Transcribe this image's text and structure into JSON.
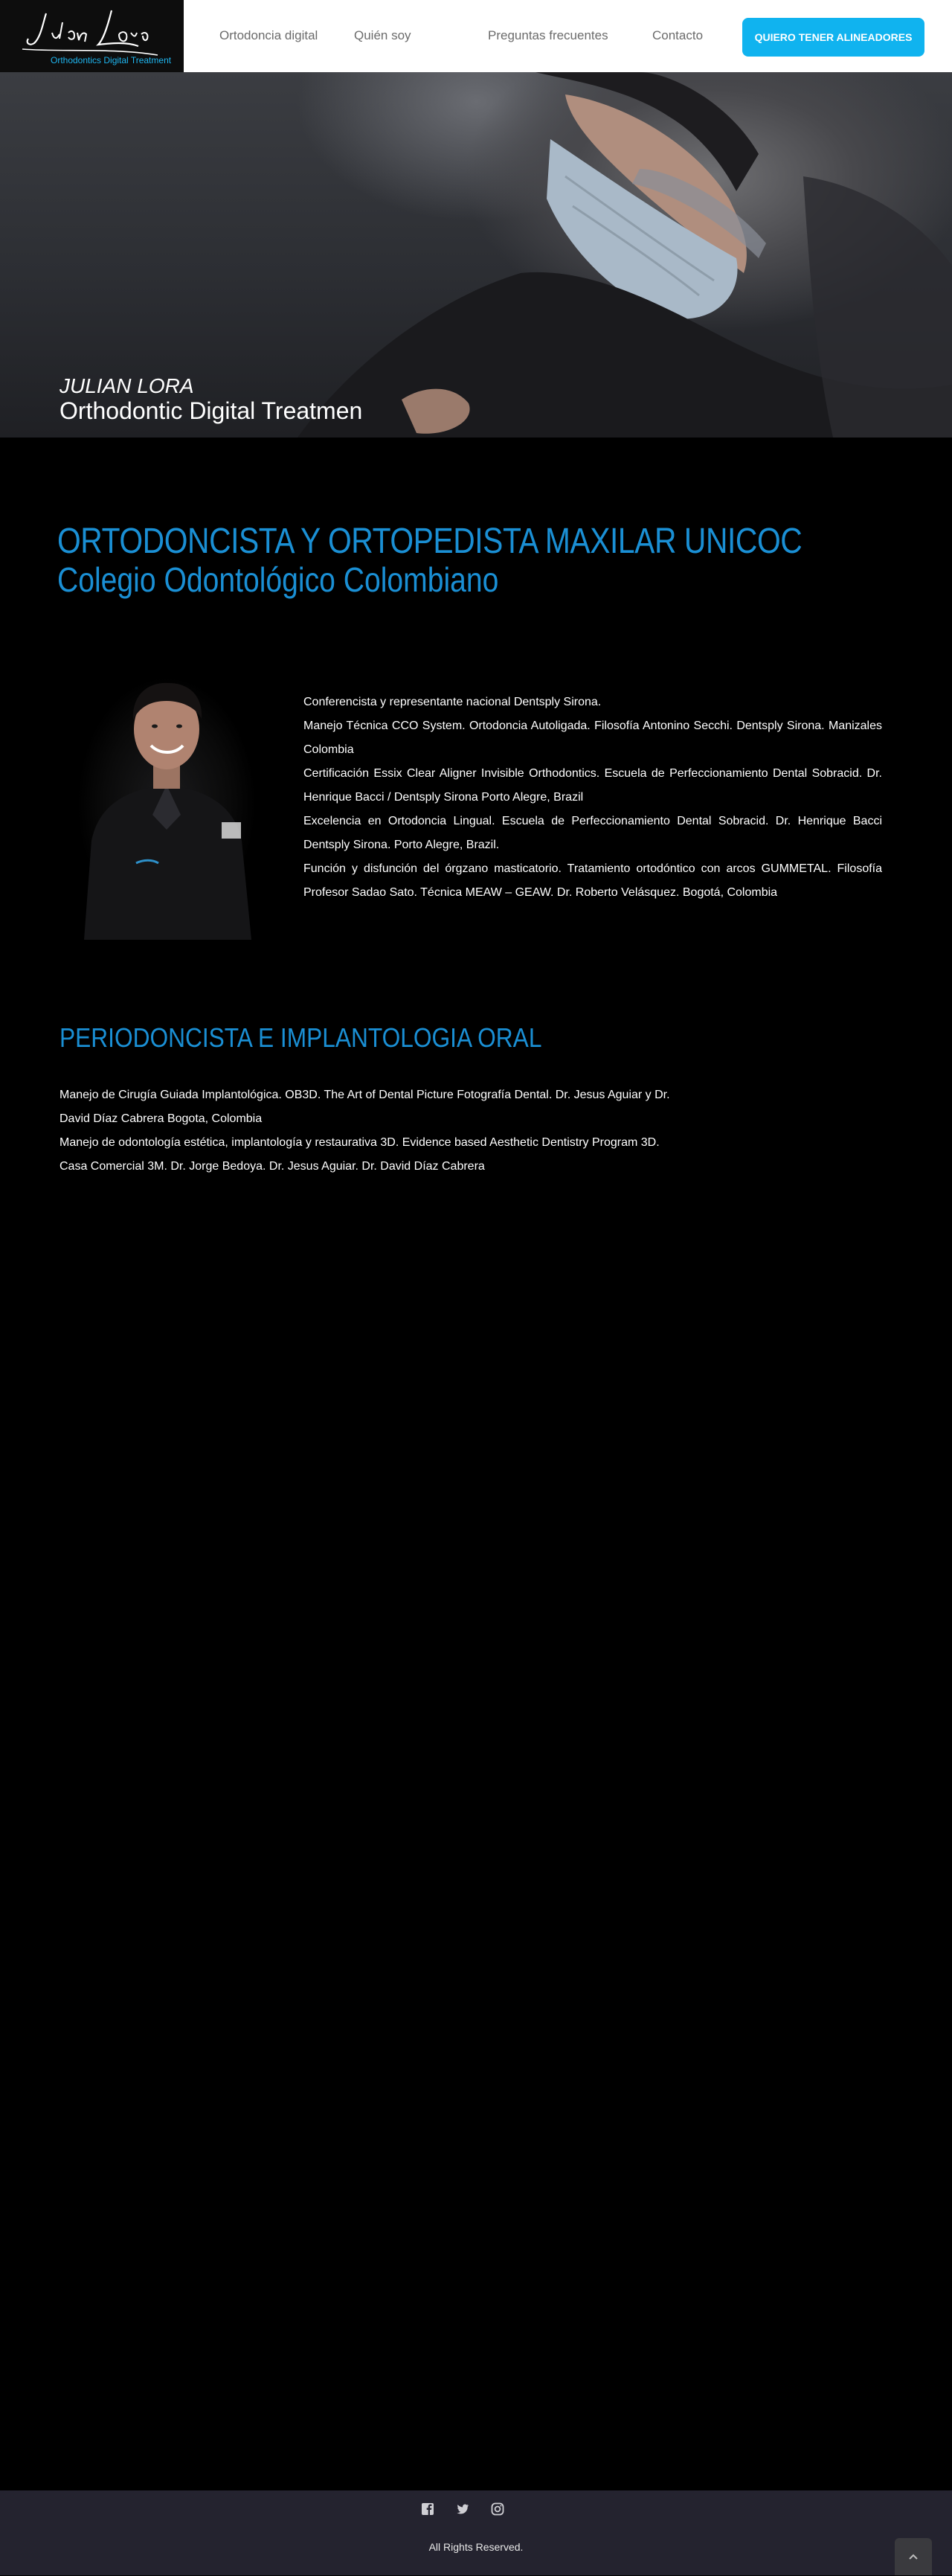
{
  "header": {
    "logo": {
      "script_text": "Julián Lora",
      "tagline": "Orthodontics Digital Treatment"
    },
    "nav": [
      {
        "label": "Ortodoncia digital"
      },
      {
        "label": "Quién soy"
      },
      {
        "label": "Preguntas frecuentes"
      },
      {
        "label": "Contacto"
      }
    ],
    "cta_label": "QUIERO TENER ALINEADORES"
  },
  "hero": {
    "name": "JULIAN LORA",
    "subtitle": "Orthodontic Digital Treatmen"
  },
  "about": {
    "title": "ORTODONCISTA Y ORTOPEDISTA MAXILAR UNICOC",
    "subtitle": "Colegio Odontológico Colombiano",
    "credentials": [
      "Conferencista y representante nacional Dentsply Sirona.",
      "Manejo Técnica CCO System. Ortodoncia Autoligada. Filosofía Antonino Secchi. Dentsply Sirona. Manizales Colombia",
      "Certificación Essix Clear Aligner Invisible Orthodontics. Escuela de Perfeccionamiento Dental Sobracid. Dr. Henrique Bacci / Dentsply Sirona Porto Alegre, Brazil",
      "Excelencia en Ortodoncia Lingual. Escuela de Perfeccionamiento Dental Sobracid. Dr. Henrique Bacci Dentsply Sirona. Porto Alegre, Brazil.",
      "Función y disfunción del órgzano masticatorio. Tratamiento ortodóntico con arcos GUMMETAL. Filosofía Profesor Sadao Sato. Técnica MEAW – GEAW. Dr. Roberto Velásquez. Bogotá, Colombia"
    ]
  },
  "perio": {
    "title": "PERIODONCISTA E IMPLANTOLOGIA ORAL",
    "lines": [
      "Manejo de Cirugía Guiada Implantológica. OB3D. The Art of Dental Picture Fotografía Dental. Dr. Jesus Aguiar y Dr. David Díaz Cabrera Bogota, Colombia",
      "Manejo de odontología estética, implantología y restaurativa 3D. Evidence based Aesthetic Dentistry Program 3D. Casa Comercial 3M. Dr. Jorge Bedoya. Dr. Jesus Aguiar. Dr. David Díaz Cabrera"
    ]
  },
  "footer": {
    "social_icons": [
      "facebook-icon",
      "twitter-icon",
      "instagram-icon"
    ],
    "copyright": "All Rights Reserved.",
    "back_to_top_icon": "chevron-up-icon"
  },
  "colors": {
    "accent": "#10b3ef",
    "heading_blue": "#1a8fd4",
    "footer_bg": "#24232f",
    "page_bg": "#000000"
  }
}
